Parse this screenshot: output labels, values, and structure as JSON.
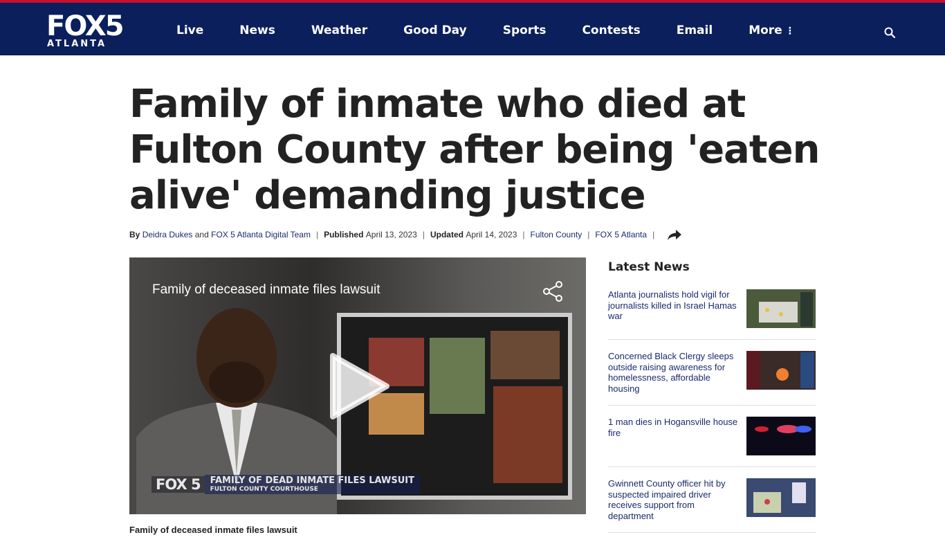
{
  "header": {
    "logo_main": "FOX5",
    "logo_city": "ATLANTA",
    "nav": [
      "Live",
      "News",
      "Weather",
      "Good Day",
      "Sports",
      "Contests",
      "Email",
      "More"
    ]
  },
  "article": {
    "headline": "Family of inmate who died at Fulton County after being 'eaten alive' demanding justice",
    "by_label": "By",
    "author1": "Deidra Dukes",
    "and_text": "and",
    "author2": "FOX 5 Atlanta Digital Team",
    "published_label": "Published",
    "published_date": "April 13, 2023",
    "updated_label": "Updated",
    "updated_date": "April 14, 2023",
    "tag1": "Fulton County",
    "tag2": "FOX 5 Atlanta"
  },
  "video": {
    "title": "Family of deceased inmate files lawsuit",
    "lower_third_logo": "FOX 5",
    "lower_third_line1": "FAMILY OF DEAD INMATE FILES LAWSUIT",
    "lower_third_line2": "FULTON COUNTY COURTHOUSE",
    "caption": "Family of deceased inmate files lawsuit"
  },
  "sidebar": {
    "title": "Latest News",
    "items": [
      {
        "headline": "Atlanta journalists hold vigil for journalists killed in Israel Hamas war"
      },
      {
        "headline": "Concerned Black Clergy sleeps outside raising awareness for homelessness, affordable housing"
      },
      {
        "headline": "1 man dies in Hogansville house fire"
      },
      {
        "headline": "Gwinnett County officer hit by suspected impaired driver receives support from department"
      }
    ]
  },
  "colors": {
    "header_bg": "#0a1f5c",
    "header_accent": "#c8102e",
    "link": "#1a2a6c"
  }
}
